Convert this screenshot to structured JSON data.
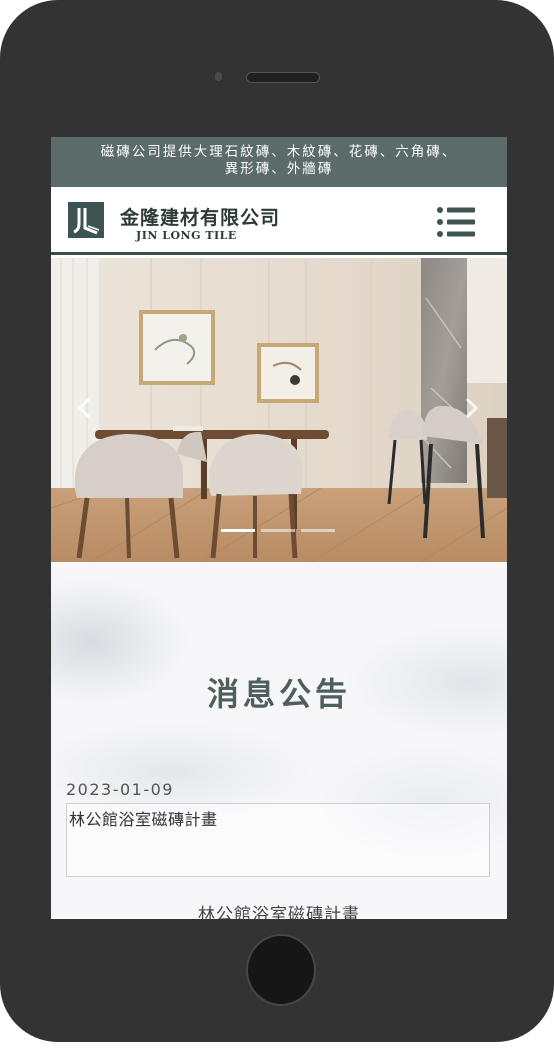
{
  "topbar": {
    "line1": "磁磚公司提供大理石紋磚、木紋磚、花磚、六角磚、",
    "line2": "異形磚、外牆磚"
  },
  "header": {
    "company_cn": "金隆建材有限公司",
    "company_en": "JIN LONG TILE",
    "menu_icon": "hamburger-menu-icon"
  },
  "banner": {
    "prev_icon": "chevron-left-icon",
    "next_icon": "chevron-right-icon",
    "slide_count": 3,
    "active_slide": 1
  },
  "news": {
    "title": "消息公告",
    "items": [
      {
        "date": "2023-01-09",
        "headline": "林公館浴室磁磚計畫",
        "caption": "林公館浴室磁磚計畫"
      }
    ]
  },
  "colors": {
    "brand": "#3d5453",
    "topbar_bg": "#5a6b69",
    "title_text": "#4e5f5d",
    "phone_body": "#333333"
  }
}
